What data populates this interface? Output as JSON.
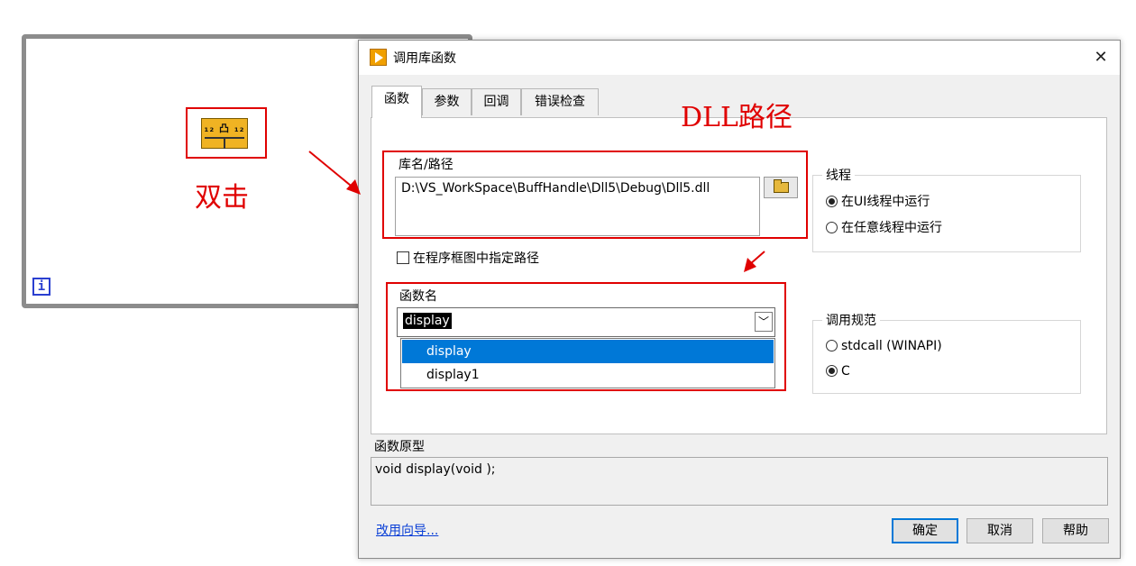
{
  "annotations": {
    "double_click": "双击",
    "dll_path": "DLL路径"
  },
  "diagram": {
    "loop_index": "i",
    "node_glyph": "₁₂ 凸 ₁₂"
  },
  "dialog": {
    "title": "调用库函数",
    "close_glyph": "✕",
    "tabs": [
      "函数",
      "参数",
      "回调",
      "错误检查"
    ],
    "active_tab": 0,
    "library": {
      "label": "库名/路径",
      "path": "D:\\VS_WorkSpace\\BuffHandle\\Dll5\\Debug\\Dll5.dll",
      "browse_icon": "folder-open-icon"
    },
    "specify_path": {
      "label": "在程序框图中指定路径",
      "checked": false
    },
    "function": {
      "label": "函数名",
      "value": "display",
      "options": [
        "display",
        "display1"
      ],
      "selected_index": 0,
      "dropdown_glyph": "﹀"
    },
    "thread": {
      "title": "线程",
      "options": [
        "在UI线程中运行",
        "在任意线程中运行"
      ],
      "selected_index": 0
    },
    "calling_convention": {
      "title": "调用规范",
      "options": [
        "stdcall (WINAPI)",
        "C"
      ],
      "selected_index": 1
    },
    "prototype": {
      "label": "函数原型",
      "text": "void  display(void );"
    },
    "wizard_link": "改用向导...",
    "buttons": {
      "ok": "确定",
      "cancel": "取消",
      "help": "帮助"
    }
  },
  "colors": {
    "annotation_red": "#e00000",
    "selection_blue": "#0078d7",
    "link_blue": "#0a3fd6"
  }
}
